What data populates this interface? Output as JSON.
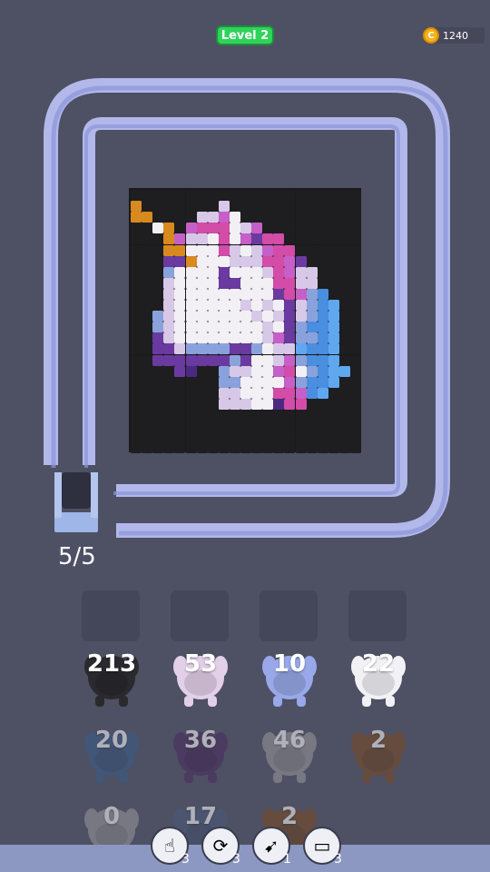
{
  "header": {
    "level_label": "Level 2",
    "coin_icon": "coin-icon",
    "coin_symbol": "C",
    "coin_count": "1240"
  },
  "cannon": {
    "ammo_text": "5/5"
  },
  "board": {
    "cols": 21,
    "rows": 24,
    "palette": {
      ".": "#1e1e20",
      "o": "#d98a1e",
      "w": "#f2f0f4",
      "l": "#d8c8e8",
      "p": "#c65fc8",
      "m": "#d24ca8",
      "v": "#6a3aa0",
      "d": "#4a2a80",
      "b": "#8aa2dc",
      "k": "#4a8ee0",
      "c": "#5fa8f0",
      "g": "#b8b8c8"
    },
    "pixels": [
      ".....................",
      "o.......l............",
      "oo....llpw...........",
      "..wo.pmmmwlp.........",
      "...opllwmwpvmm.......",
      "...oowwwmlwlpmm......",
      "...vvowwwlllmmpv.....",
      "...bwwwwvwwwlmpll....",
      "...lwwwwvvwwwmmll....",
      "...lwwwwwwwwwvmpbk...",
      "...lwwwwwwlwlwvlbkc..",
      "..blwwwwwwwlwlvlbkc..",
      "..blwwwwwwwwlwvbkkc..",
      "..vlwwwwwwwwlpvbbkc..",
      "..vvlbbbbvvbwllckkc..",
      "..vvvvvvvbvwwlpbkkc..",
      "....vd..bllwwpmwbkcc.",
      "........bbwwwwpbkkc..",
      "........llwwwmmpkc...",
      "........lllwwdmm.....",
      ".....................",
      ".....................",
      ".....................",
      "....................."
    ]
  },
  "slots": [
    {},
    {},
    {},
    {}
  ],
  "shooters": [
    {
      "count": "213",
      "color": "#2a2a2e",
      "dim": false
    },
    {
      "count": "53",
      "color": "#e2cfe8",
      "dim": false
    },
    {
      "count": "10",
      "color": "#98a8e8",
      "dim": false
    },
    {
      "count": "22",
      "color": "#f2f2f6",
      "dim": false
    },
    {
      "count": "20",
      "color": "#3a5c88",
      "dim": true
    },
    {
      "count": "36",
      "color": "#4a2a5e",
      "dim": true
    },
    {
      "count": "46",
      "color": "#9a9a9a",
      "dim": true
    },
    {
      "count": "2",
      "color": "#7a4a22",
      "dim": true
    },
    {
      "count": "0",
      "color": "#9a9a9a",
      "dim": true
    },
    {
      "count": "17",
      "color": "#4a5a7a",
      "dim": true
    },
    {
      "count": "2",
      "color": "#7a4a22",
      "dim": true
    }
  ],
  "boosters": [
    {
      "name": "tap-hand-icon",
      "glyph": "☝",
      "count": "3"
    },
    {
      "name": "shuffle-icon",
      "glyph": "⟳",
      "count": "3"
    },
    {
      "name": "launcher-icon",
      "glyph": "➹",
      "count": "1"
    },
    {
      "name": "cards-icon",
      "glyph": "▭",
      "count": "3"
    }
  ]
}
